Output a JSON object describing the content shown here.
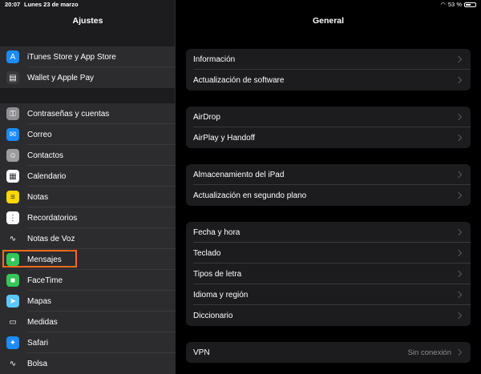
{
  "status": {
    "time": "20:07",
    "date": "Lunes 23 de marzo",
    "battery": "53 %",
    "battery_level": 0.53
  },
  "sidebar": {
    "title": "Ajustes",
    "group1": [
      {
        "label": "iTunes Store y App Store",
        "icon": "app-store-icon",
        "color": "#1a8cff",
        "glyph": "A"
      },
      {
        "label": "Wallet y Apple Pay",
        "icon": "wallet-icon",
        "color": "#3a3a3c",
        "glyph": "▤"
      }
    ],
    "group2": [
      {
        "label": "Contraseñas y cuentas",
        "icon": "key-icon",
        "color": "#8e8e93",
        "glyph": "⚿"
      },
      {
        "label": "Correo",
        "icon": "mail-icon",
        "color": "#1a8cff",
        "glyph": "✉"
      },
      {
        "label": "Contactos",
        "icon": "contacts-icon",
        "color": "#9c9c9c",
        "glyph": "☺"
      },
      {
        "label": "Calendario",
        "icon": "calendar-icon",
        "color": "#ffffff",
        "glyph": "▦"
      },
      {
        "label": "Notas",
        "icon": "notes-icon",
        "color": "#ffd60a",
        "glyph": "≡"
      },
      {
        "label": "Recordatorios",
        "icon": "reminders-icon",
        "color": "#ffffff",
        "glyph": "⋮"
      },
      {
        "label": "Notas de Voz",
        "icon": "voice-memos-icon",
        "color": "#2c2c2e",
        "glyph": "∿"
      },
      {
        "label": "Mensajes",
        "icon": "messages-icon",
        "color": "#34c759",
        "glyph": "●"
      },
      {
        "label": "FaceTime",
        "icon": "facetime-icon",
        "color": "#34c759",
        "glyph": "■"
      },
      {
        "label": "Mapas",
        "icon": "maps-icon",
        "color": "#5ac8fa",
        "glyph": "➤"
      },
      {
        "label": "Medidas",
        "icon": "measure-icon",
        "color": "#2c2c2e",
        "glyph": "▭"
      },
      {
        "label": "Safari",
        "icon": "safari-icon",
        "color": "#1a8cff",
        "glyph": "✦"
      },
      {
        "label": "Bolsa",
        "icon": "stocks-icon",
        "color": "#2c2c2e",
        "glyph": "∿"
      }
    ]
  },
  "main": {
    "title": "General",
    "cards": [
      [
        {
          "label": "Información"
        },
        {
          "label": "Actualización de software"
        }
      ],
      [
        {
          "label": "AirDrop"
        },
        {
          "label": "AirPlay y Handoff"
        }
      ],
      [
        {
          "label": "Almacenamiento del iPad"
        },
        {
          "label": "Actualización en segundo plano"
        }
      ],
      [
        {
          "label": "Fecha y hora"
        },
        {
          "label": "Teclado"
        },
        {
          "label": "Tipos de letra"
        },
        {
          "label": "Idioma y región"
        },
        {
          "label": "Diccionario"
        }
      ],
      [
        {
          "label": "VPN",
          "value": "Sin conexión"
        }
      ]
    ]
  }
}
